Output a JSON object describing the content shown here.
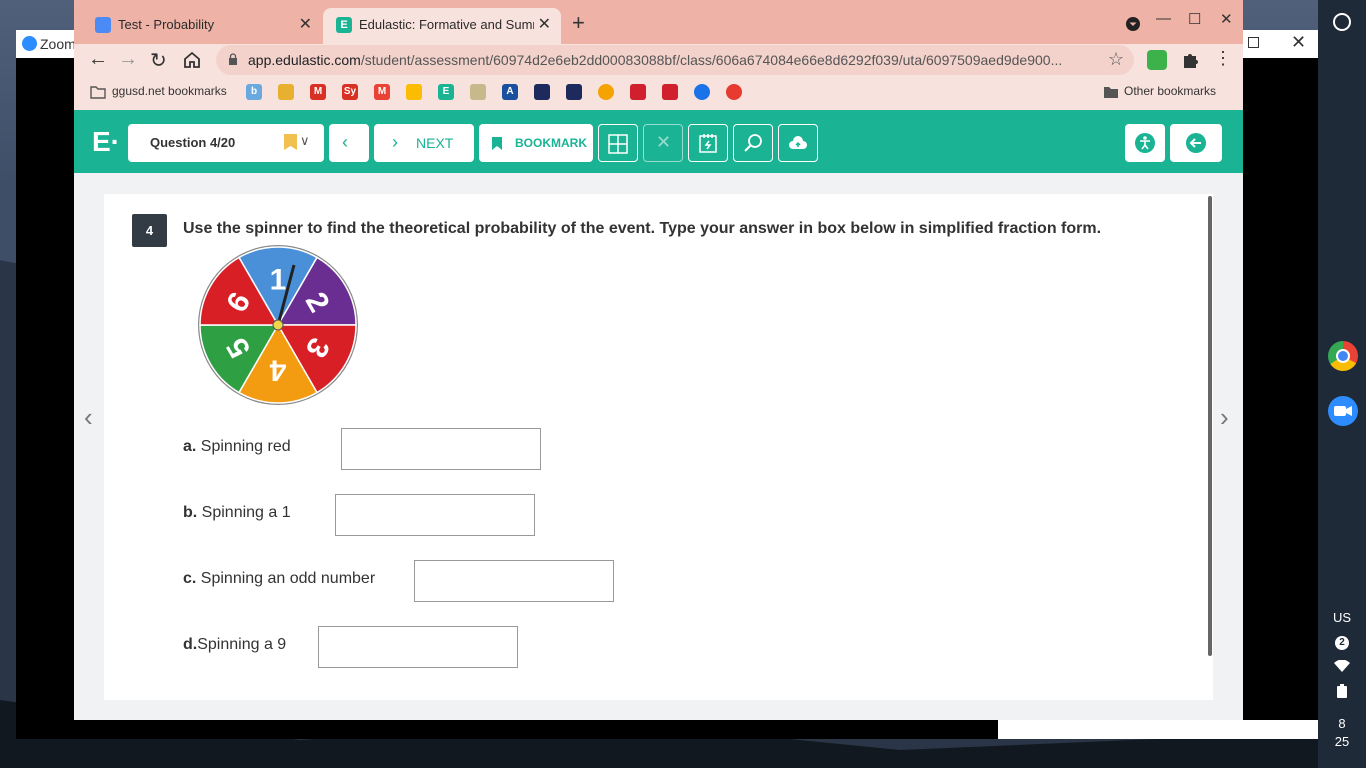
{
  "background_window": {
    "title": "Zoom"
  },
  "browser": {
    "tabs": [
      {
        "title": "Test - Probability",
        "active": false
      },
      {
        "title": "Edulastic: Formative and Summ",
        "active": true
      }
    ],
    "url_domain": "app.edulastic.com",
    "url_path": "/student/assessment/60974d2e6eb2dd00083088bf/class/606a674084e66e8d6292f039/uta/6097509aed9de900...",
    "bookmarks": {
      "folder_label": "ggusd.net bookmarks",
      "other_label": "Other bookmarks"
    }
  },
  "header": {
    "logo": "E·",
    "question_selector": "Question 4/20",
    "next_label": "NEXT",
    "bookmark_label": "BOOKMARK"
  },
  "question": {
    "number": "4",
    "prompt": "Use the spinner to find the theoretical probability of the event. Type your answer in box below in simplified fraction form.",
    "spinner_sections": [
      {
        "label": "1",
        "color": "#4a90d9"
      },
      {
        "label": "2",
        "color": "#6a2d91"
      },
      {
        "label": "3",
        "color": "#d91f26"
      },
      {
        "label": "4",
        "color": "#f39c12"
      },
      {
        "label": "5",
        "color": "#2ea043"
      },
      {
        "label": "6",
        "color": "#d91f26"
      }
    ],
    "parts": [
      {
        "prefix": "a.",
        "text": " Spinning red",
        "value": ""
      },
      {
        "prefix": "b.",
        "text": " Spinning a 1",
        "value": ""
      },
      {
        "prefix": "c.",
        "text": " Spinning an odd number",
        "value": ""
      },
      {
        "prefix": "d.",
        "text": "Spinning a 9",
        "value": ""
      }
    ]
  },
  "system_tray": {
    "keyboard": "US",
    "notifications": "2",
    "time_hour": "8",
    "time_min": "25"
  },
  "colors": {
    "brand": "#1ab394",
    "tabstrip": "#eeb3a6",
    "toolbar": "#f8e2dd"
  }
}
